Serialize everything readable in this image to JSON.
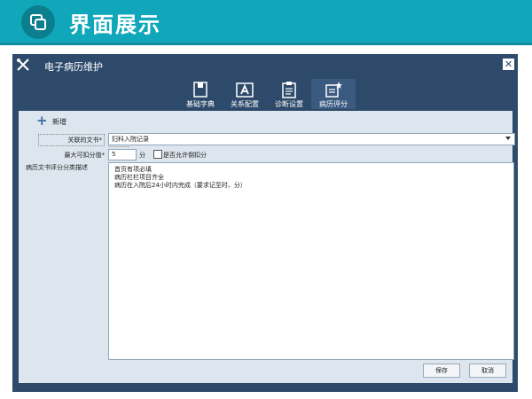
{
  "slide": {
    "title": "界面展示",
    "icon": "windows-icon"
  },
  "window": {
    "title": "电子病历维护",
    "icon": "tools-icon",
    "close_icon": "close-icon",
    "close_label": "✕"
  },
  "tabs": [
    {
      "label": "基础字典",
      "icon": "book-icon",
      "active": false
    },
    {
      "label": "关系配置",
      "icon": "letter-a-icon",
      "active": false
    },
    {
      "label": "诊断设置",
      "icon": "clipboard-icon",
      "active": false
    },
    {
      "label": "病历评分",
      "icon": "star-document-icon",
      "active": true
    }
  ],
  "toolbar": {
    "add_label": "新增",
    "add_icon": "plus-icon",
    "add_glyph": "+"
  },
  "form": {
    "doc_label": "关联的文书*",
    "doc_value": "妇科入院记录",
    "max_label": "最大可扣分值*",
    "max_value": "5",
    "unit": "分",
    "allow_repeat_label": "是否允许倒扣分",
    "allow_repeat_checked": false,
    "desc_label": "病历文书评分分类描述",
    "desc_lines": [
      "首页有项必填",
      "病历栏栏项目齐全",
      "病历在入院后24小时内完成（要求记至时、分）"
    ]
  },
  "buttons": {
    "save": "保存",
    "cancel": "取消"
  },
  "colors": {
    "header": "#0fa7b9",
    "window": "#2e4a6b",
    "content": "#dde6ee",
    "active_tab": "#3a5a80"
  }
}
